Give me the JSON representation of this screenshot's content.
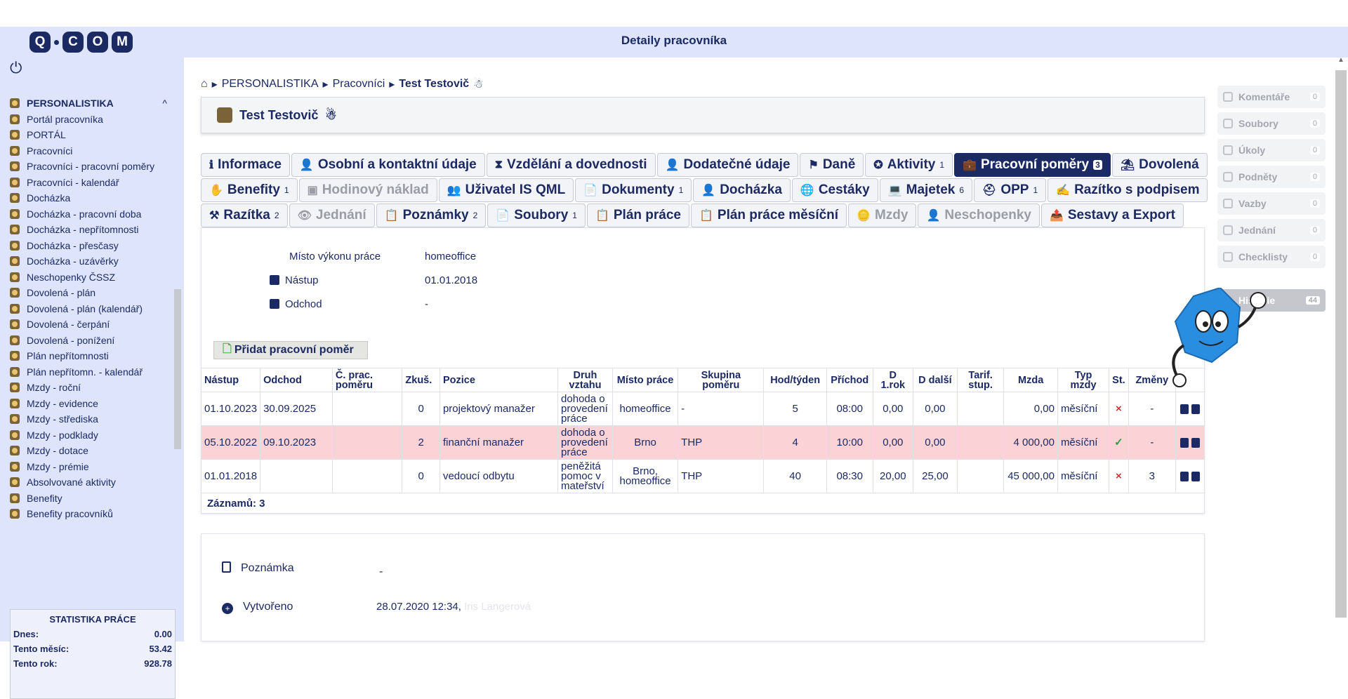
{
  "app": {
    "title": "Detaily pracovníka",
    "logo_text": "Q·COM"
  },
  "sidebar": {
    "items": [
      {
        "label": "PERSONALISTIKA",
        "head": true,
        "toggle": "^"
      },
      {
        "label": "Portál pracovníka"
      },
      {
        "label": "PORTÁL"
      },
      {
        "label": "Pracovníci"
      },
      {
        "label": "Pracovníci - pracovní poměry"
      },
      {
        "label": "Pracovníci - kalendář"
      },
      {
        "label": "Docházka"
      },
      {
        "label": "Docházka - pracovní doba"
      },
      {
        "label": "Docházka - nepřítomnosti"
      },
      {
        "label": "Docházka - přesčasy"
      },
      {
        "label": "Docházka - uzávěrky"
      },
      {
        "label": "Neschopenky ČSSZ"
      },
      {
        "label": "Dovolená - plán"
      },
      {
        "label": "Dovolená - plán (kalendář)"
      },
      {
        "label": "Dovolená - čerpání"
      },
      {
        "label": "Dovolená - ponížení"
      },
      {
        "label": "Plán nepřítomnosti"
      },
      {
        "label": "Plán nepřítomn. - kalendář"
      },
      {
        "label": "Mzdy - roční"
      },
      {
        "label": "Mzdy - evidence"
      },
      {
        "label": "Mzdy - střediska"
      },
      {
        "label": "Mzdy - podklady"
      },
      {
        "label": "Mzdy - dotace"
      },
      {
        "label": "Mzdy - prémie"
      },
      {
        "label": "Absolvované aktivity"
      },
      {
        "label": "Benefity"
      },
      {
        "label": "Benefity pracovníků"
      }
    ],
    "stats": {
      "title": "STATISTIKA PRÁCE",
      "rows": [
        {
          "label": "Dnes:",
          "value": "0.00"
        },
        {
          "label": "Tento měsíc:",
          "value": "53.42"
        },
        {
          "label": "Tento rok:",
          "value": "928.78"
        }
      ]
    }
  },
  "breadcrumb": {
    "items": [
      "PERSONALISTIKA",
      "Pracovníci"
    ],
    "current": "Test Testovič"
  },
  "header": {
    "name": "Test Testovič"
  },
  "tabs": {
    "row1": [
      {
        "label": "Informace",
        "icon": "info-icon",
        "glyph": "ℹ"
      },
      {
        "label": "Osobní a kontaktní údaje",
        "icon": "user-lock-icon",
        "glyph": "👤"
      },
      {
        "label": "Vzdělání a dovednosti",
        "icon": "hourglass-icon",
        "glyph": "⧗"
      },
      {
        "label": "Dodatečné údaje",
        "icon": "user-plus-icon",
        "glyph": "👤"
      },
      {
        "label": "Daně",
        "icon": "tax-icon",
        "glyph": "⚑"
      },
      {
        "label": "Aktivity",
        "icon": "award-icon",
        "glyph": "✪",
        "count": "1"
      },
      {
        "label": "Pracovní poměry",
        "icon": "briefcase-icon",
        "glyph": "💼",
        "count": "3",
        "active": true
      },
      {
        "label": "Dovolená",
        "icon": "umbrella-icon",
        "glyph": "⛱"
      }
    ],
    "row2": [
      {
        "label": "Benefity",
        "icon": "hand-icon",
        "glyph": "✋",
        "count": "1"
      },
      {
        "label": "Hodinový náklad",
        "icon": "money-icon",
        "glyph": "▣",
        "disabled": true
      },
      {
        "label": "Uživatel IS QML",
        "icon": "users-icon",
        "glyph": "👥"
      },
      {
        "label": "Dokumenty",
        "icon": "pdf-icon",
        "glyph": "📄",
        "count": "1"
      },
      {
        "label": "Docházka",
        "icon": "user-clock-icon",
        "glyph": "👤"
      },
      {
        "label": "Cestáky",
        "icon": "globe-icon",
        "glyph": "🌐"
      },
      {
        "label": "Majetek",
        "icon": "laptop-icon",
        "glyph": "💻",
        "count": "6"
      },
      {
        "label": "OPP",
        "icon": "helmet-icon",
        "glyph": "⛑",
        "count": "1"
      },
      {
        "label": "Razítko s podpisem",
        "icon": "signature-icon",
        "glyph": "✍"
      }
    ],
    "row3": [
      {
        "label": "Razítka",
        "icon": "stamp-icon",
        "glyph": "⚒",
        "count": "2"
      },
      {
        "label": "Jednání",
        "icon": "eye-icon",
        "glyph": "👁",
        "disabled": true
      },
      {
        "label": "Poznámky",
        "icon": "clipboard-icon",
        "glyph": "📋",
        "count": "2"
      },
      {
        "label": "Soubory",
        "icon": "file-pdf-icon",
        "glyph": "📄",
        "count": "1"
      },
      {
        "label": "Plán práce",
        "icon": "clipboard-list-icon",
        "glyph": "📋"
      },
      {
        "label": "Plán práce měsíční",
        "icon": "clipboard-list-icon",
        "glyph": "📋"
      },
      {
        "label": "Mzdy",
        "icon": "coins-icon",
        "glyph": "🪙",
        "disabled": true
      },
      {
        "label": "Neschopenky",
        "icon": "user-injured-icon",
        "glyph": "👤",
        "disabled": true
      },
      {
        "label": "Sestavy a Export",
        "icon": "file-export-icon",
        "glyph": "📤"
      }
    ]
  },
  "info": {
    "misto_label": "Místo výkonu práce",
    "misto_value": "homeoffice",
    "nastup_label": "Nástup",
    "nastup_value": "01.01.2018",
    "odchod_label": "Odchod",
    "odchod_value": "-"
  },
  "add_button": "Přidat pracovní poměr",
  "table": {
    "headers": [
      "Nástup",
      "Odchod",
      "Č. prac. poměru",
      "Zkuš.",
      "Pozice",
      "Druh vztahu",
      "Místo práce",
      "Skupina poměru",
      "Hod/týden",
      "Příchod",
      "D 1.rok",
      "D další",
      "Tarif. stup.",
      "Mzda",
      "Typ mzdy",
      "St.",
      "Změny",
      ""
    ],
    "rows": [
      {
        "nastup": "01.10.2023",
        "odchod": "30.09.2025",
        "cislo": "",
        "zkus": "0",
        "pozice": "projektový manažer",
        "druh": "dohoda o provedení práce",
        "misto": "homeoffice",
        "skupina": "-",
        "hod": "5",
        "prichod": "08:00",
        "d1": "0,00",
        "d2": "0,00",
        "tarif": "",
        "mzda": "0,00",
        "typ": "měsíční",
        "st": "×",
        "st_ok": false,
        "zmeny": "-",
        "pink": false
      },
      {
        "nastup": "05.10.2022",
        "odchod": "09.10.2023",
        "cislo": "",
        "zkus": "2",
        "pozice": "finanční manažer",
        "druh": "dohoda o provedení práce",
        "misto": "Brno",
        "skupina": "THP",
        "hod": "4",
        "prichod": "10:00",
        "d1": "0,00",
        "d2": "0,00",
        "tarif": "",
        "mzda": "4 000,00",
        "typ": "měsíční",
        "st": "✓",
        "st_ok": true,
        "zmeny": "-",
        "pink": true
      },
      {
        "nastup": "01.01.2018",
        "odchod": "",
        "cislo": "",
        "zkus": "0",
        "pozice": "vedoucí odbytu",
        "druh": "peněžitá pomoc v mateřství",
        "misto": "Brno, homeoffice",
        "skupina": "THP",
        "hod": "40",
        "prichod": "08:30",
        "d1": "20,00",
        "d2": "25,00",
        "tarif": "",
        "mzda": "45 000,00",
        "typ": "měsíční",
        "st": "×",
        "st_ok": false,
        "zmeny": "3",
        "pink": false
      }
    ],
    "count_label": "Záznamů: 3"
  },
  "notes": {
    "poznamka_label": "Poznámka",
    "poznamka_value": "-",
    "vytvoreno_label": "Vytvořeno",
    "vytvoreno_value": "28.07.2020 12:34,",
    "vytvoreno_user": "Iris Langerová"
  },
  "right_panel": [
    {
      "label": "Komentáře",
      "count": "0",
      "icon": "comment-icon"
    },
    {
      "label": "Soubory",
      "count": "0",
      "icon": "file-icon"
    },
    {
      "label": "Úkoly",
      "count": "0",
      "icon": "task-icon"
    },
    {
      "label": "Podněty",
      "count": "0",
      "icon": "lightbulb-icon"
    },
    {
      "label": "Vazby",
      "count": "0",
      "icon": "link-icon"
    },
    {
      "label": "Jednání",
      "count": "0",
      "icon": "meeting-icon"
    },
    {
      "label": "Checklisty",
      "count": "0",
      "icon": "checklist-icon"
    },
    {
      "label": "Historie",
      "count": "44",
      "icon": "history-icon",
      "hist": true
    }
  ]
}
